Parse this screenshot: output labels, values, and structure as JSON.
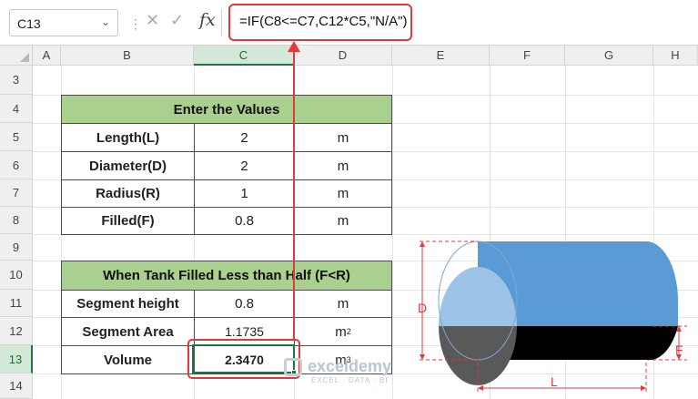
{
  "formula_bar": {
    "cell_ref": "C13",
    "fx": "fx",
    "formula": "=IF(C8<=C7,C12*C5,\"N/A\")"
  },
  "columns": [
    "A",
    "B",
    "C",
    "D",
    "E",
    "F",
    "G",
    "H"
  ],
  "rows": [
    "3",
    "4",
    "5",
    "6",
    "7",
    "8",
    "9",
    "10",
    "11",
    "12",
    "13",
    "14"
  ],
  "selected_column": "C",
  "selected_row": "13",
  "table1": {
    "title": "Enter the Values",
    "rows": [
      {
        "label": "Length(L)",
        "value": "2",
        "unit": "m"
      },
      {
        "label": "Diameter(D)",
        "value": "2",
        "unit": "m"
      },
      {
        "label": "Radius(R)",
        "value": "1",
        "unit": "m"
      },
      {
        "label": "Filled(F)",
        "value": "0.8",
        "unit": "m"
      }
    ]
  },
  "table2": {
    "title": "When Tank Filled Less than Half (F<R)",
    "rows": [
      {
        "label": "Segment height",
        "value": "0.8",
        "unit": "m",
        "unit_sup": ""
      },
      {
        "label": "Segment Area",
        "value": "1.1735",
        "unit": "m",
        "unit_sup": "2"
      },
      {
        "label": "Volume",
        "value": "2.3470",
        "unit": "m",
        "unit_sup": "3"
      }
    ]
  },
  "diagram": {
    "label_d": "D",
    "label_f": "F",
    "label_l": "L",
    "colors": {
      "tank_body": "#5b9bd5",
      "tank_end": "#9dc3e6",
      "liquid_body": "#000000",
      "liquid_end": "#595959",
      "dimension": "#e0393e"
    }
  },
  "watermark": {
    "name": "exceldemy",
    "tagline": "EXCEL · DATA · BI"
  },
  "colors": {
    "header_green": "#a9d08e",
    "selection": "#217346",
    "highlight": "#e0393e"
  }
}
